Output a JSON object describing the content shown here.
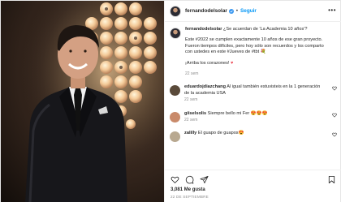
{
  "post": {
    "username": "fernandodelsolar",
    "follow_label": "Seguir",
    "more_label": "•••",
    "separator": "•"
  },
  "caption": {
    "username": "fernandodelsolar",
    "line1": "¿Se acuerdan de 'La Academia 10 años'?",
    "line2": "Este #2022 se cumplen exactamente 10 años de ese gran proyecto. Fueron tiempos difíciles, pero hoy sólo son recuerdos y los comparto con ustedes en este #Jueves de #tbt ",
    "line3": "¡Arriba los corazones! ",
    "time": "22 sem"
  },
  "comments": [
    {
      "username": "eduardojdiazchang",
      "text": "Al igual también estuvisteis en la 1 generación de la academia USA",
      "meta": "22 sem",
      "avatar_color": "#5a4a3a"
    },
    {
      "username": "giiselsolis",
      "text": "Siempre bello mi Fer ",
      "emoji": "😍😍😍",
      "meta": "22 sem",
      "avatar_color": "#c98a6a"
    },
    {
      "username": "zalilly",
      "text": "El guapo de guapos",
      "emoji": "😍",
      "meta": "",
      "avatar_color": "#b8a890"
    }
  ],
  "actions": {
    "likes": "3,081 Me gusta",
    "date": "22 DE SEPTIEMBRE"
  },
  "colors": {
    "accent": "#0095f6",
    "heart": "#ed4956",
    "verified": "#3897f0"
  }
}
